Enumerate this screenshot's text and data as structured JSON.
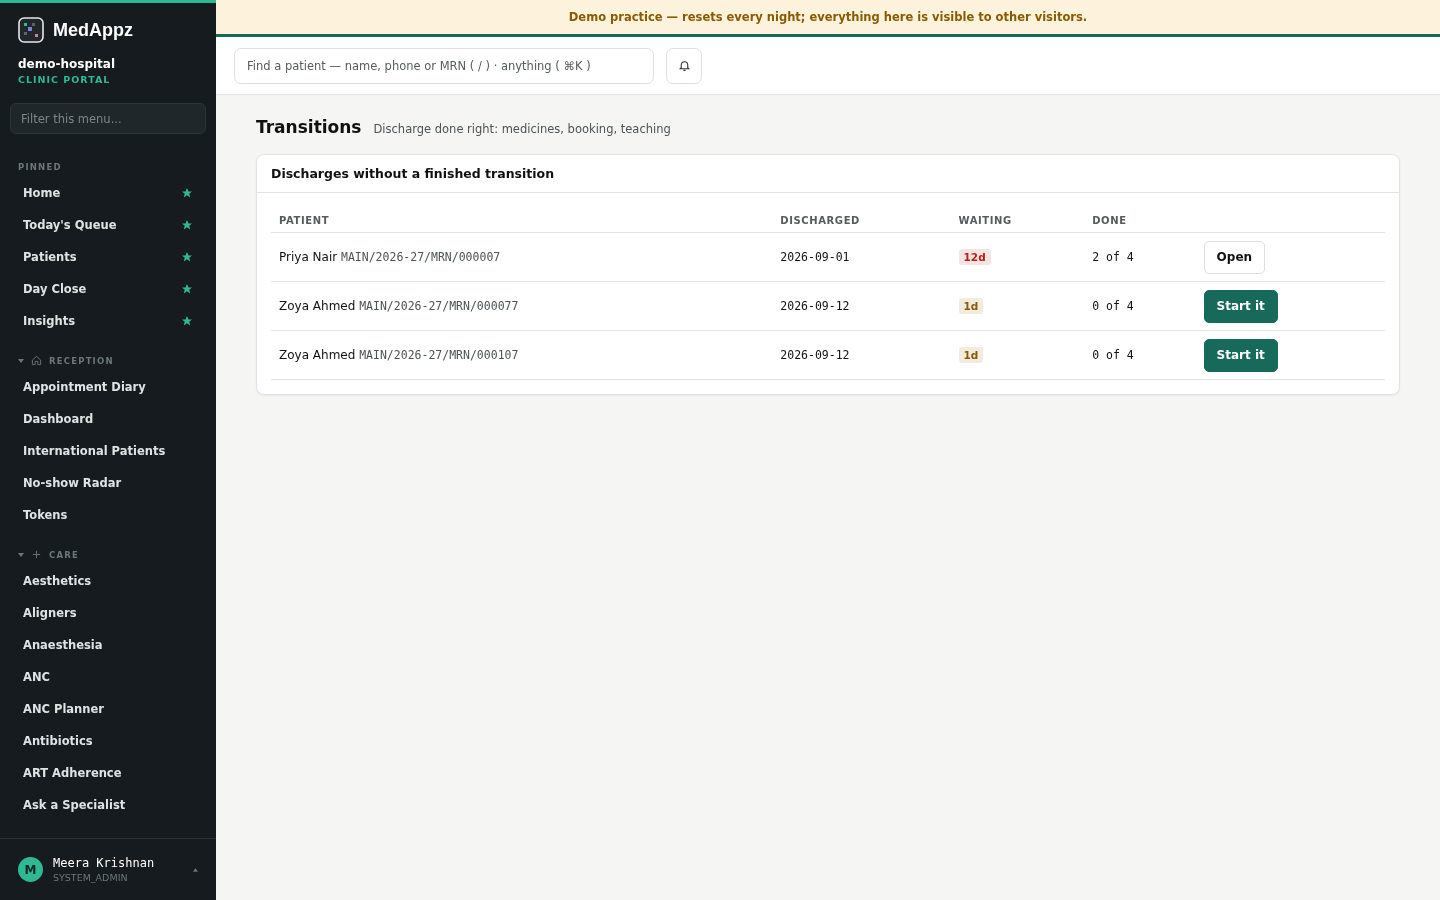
{
  "brand": {
    "name": "MedAppz",
    "org": "demo-hospital",
    "portal": "CLINIC PORTAL"
  },
  "sidebar": {
    "filter_placeholder": "Filter this menu...",
    "pinned": {
      "title": "PINNED",
      "items": [
        {
          "label": "Home",
          "starred": true
        },
        {
          "label": "Today's Queue",
          "starred": true
        },
        {
          "label": "Patients",
          "starred": true
        },
        {
          "label": "Day Close",
          "starred": true
        },
        {
          "label": "Insights",
          "starred": true
        }
      ]
    },
    "sections": [
      {
        "title": "RECEPTION",
        "expanded": true,
        "items": [
          "Appointment Diary",
          "Dashboard",
          "International Patients",
          "No-show Radar",
          "Tokens"
        ]
      },
      {
        "title": "CARE",
        "expanded": true,
        "items": [
          "Aesthetics",
          "Aligners",
          "Anaesthesia",
          "ANC",
          "ANC Planner",
          "Antibiotics",
          "ART Adherence",
          "Ask a Specialist"
        ]
      }
    ],
    "user": {
      "initial": "M",
      "name": "Meera Krishnan",
      "role": "SYSTEM_ADMIN"
    }
  },
  "banner": "Demo practice — resets every night; everything here is visible to other visitors.",
  "search": {
    "placeholder": "Find a patient — name, phone or MRN ( / ) · anything ( ⌘K )"
  },
  "page": {
    "title": "Transitions",
    "subtitle": "Discharge done right: medicines, booking, teaching"
  },
  "card": {
    "title": "Discharges without a finished transition",
    "columns": [
      "PATIENT",
      "DISCHARGED",
      "WAITING",
      "DONE"
    ],
    "rows": [
      {
        "name": "Priya Nair",
        "mrn": "MAIN/2026-27/MRN/000007",
        "discharged": "2026-09-01",
        "waiting": "12d",
        "color": "#b42318",
        "done": "2 of 4",
        "action": {
          "label": "Open",
          "kind": "secondary"
        }
      },
      {
        "name": "Zoya Ahmed",
        "mrn": "MAIN/2026-27/MRN/000077",
        "discharged": "2026-09-12",
        "waiting": "1d",
        "color": "#8a5a00",
        "done": "0 of 4",
        "action": {
          "label": "Start it",
          "kind": "primary"
        }
      },
      {
        "name": "Zoya Ahmed",
        "mrn": "MAIN/2026-27/MRN/000107",
        "discharged": "2026-09-12",
        "waiting": "1d",
        "color": "#8a5a00",
        "done": "0 of 4",
        "action": {
          "label": "Start it",
          "kind": "primary"
        }
      }
    ]
  }
}
